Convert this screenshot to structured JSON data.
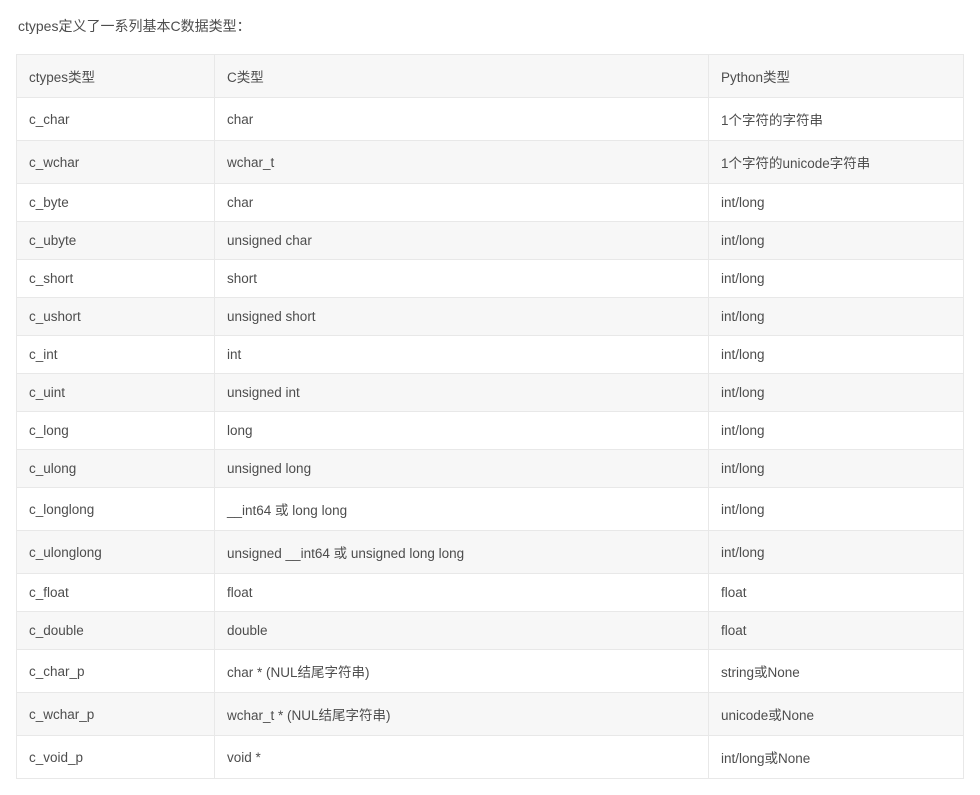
{
  "intro": "ctypes定义了一系列基本C数据类型：",
  "headers": {
    "col1": "ctypes类型",
    "col2": "C类型",
    "col3": "Python类型"
  },
  "rows": [
    {
      "col1": "c_char",
      "col2": "char",
      "col3": "1个字符的字符串"
    },
    {
      "col1": "c_wchar",
      "col2": "wchar_t",
      "col3": "1个字符的unicode字符串"
    },
    {
      "col1": "c_byte",
      "col2": "char",
      "col3": "int/long"
    },
    {
      "col1": "c_ubyte",
      "col2": "unsigned char",
      "col3": "int/long"
    },
    {
      "col1": "c_short",
      "col2": "short",
      "col3": "int/long"
    },
    {
      "col1": "c_ushort",
      "col2": "unsigned short",
      "col3": "int/long"
    },
    {
      "col1": "c_int",
      "col2": "int",
      "col3": "int/long"
    },
    {
      "col1": "c_uint",
      "col2": "unsigned int",
      "col3": "int/long"
    },
    {
      "col1": "c_long",
      "col2": "long",
      "col3": "int/long"
    },
    {
      "col1": "c_ulong",
      "col2": "unsigned long",
      "col3": "int/long"
    },
    {
      "col1": "c_longlong",
      "col2": "__int64 或 long long",
      "col3": "int/long"
    },
    {
      "col1": "c_ulonglong",
      "col2": "unsigned __int64 或 unsigned long long",
      "col3": "int/long"
    },
    {
      "col1": "c_float",
      "col2": "float",
      "col3": "float"
    },
    {
      "col1": "c_double",
      "col2": "double",
      "col3": "float"
    },
    {
      "col1": "c_char_p",
      "col2": "char * (NUL结尾字符串)",
      "col3": "string或None"
    },
    {
      "col1": "c_wchar_p",
      "col2": "wchar_t * (NUL结尾字符串)",
      "col3": "unicode或None"
    },
    {
      "col1": "c_void_p",
      "col2": "void *",
      "col3": "int/long或None"
    }
  ]
}
